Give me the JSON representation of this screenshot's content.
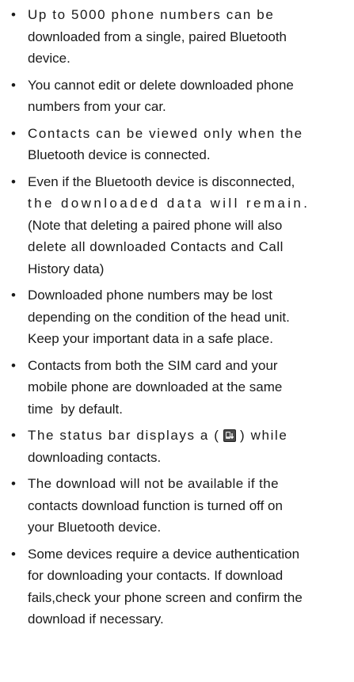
{
  "bullet": "•",
  "items": [
    {
      "parts": [
        "Up to 5000 phone numbers can be",
        "downloaded from a single, paired Bluetooth",
        "device."
      ]
    },
    {
      "parts": [
        "You cannot edit or delete downloaded phone",
        "numbers from your car."
      ]
    },
    {
      "parts": [
        "Contacts can be viewed only when the",
        "Bluetooth device is connected."
      ]
    },
    {
      "parts": [
        "Even if the Bluetooth device is disconnected,",
        "the downloaded data will remain.",
        "(Note that deleting a paired phone will also",
        "delete all downloaded Contacts and Call",
        "History data)"
      ]
    },
    {
      "parts": [
        "Downloaded phone numbers may be lost",
        "depending on the condition of the head unit.",
        "Keep your important data in a safe place."
      ]
    },
    {
      "parts": [
        "Contacts from both the SIM card and your",
        "mobile phone are downloaded at the same",
        "time  by default."
      ]
    },
    {
      "before": "The status bar displays a (",
      "after": ") while",
      "rest": "downloading contacts.",
      "icon": "download-contacts-icon"
    },
    {
      "parts": [
        "The download will not be available if the",
        "contacts download function is turned off on",
        "your Bluetooth device."
      ]
    },
    {
      "parts": [
        "Some devices require a device authentication",
        "for downloading your contacts. If download",
        "fails,check your phone screen and confirm the",
        "download if necessary."
      ]
    }
  ]
}
